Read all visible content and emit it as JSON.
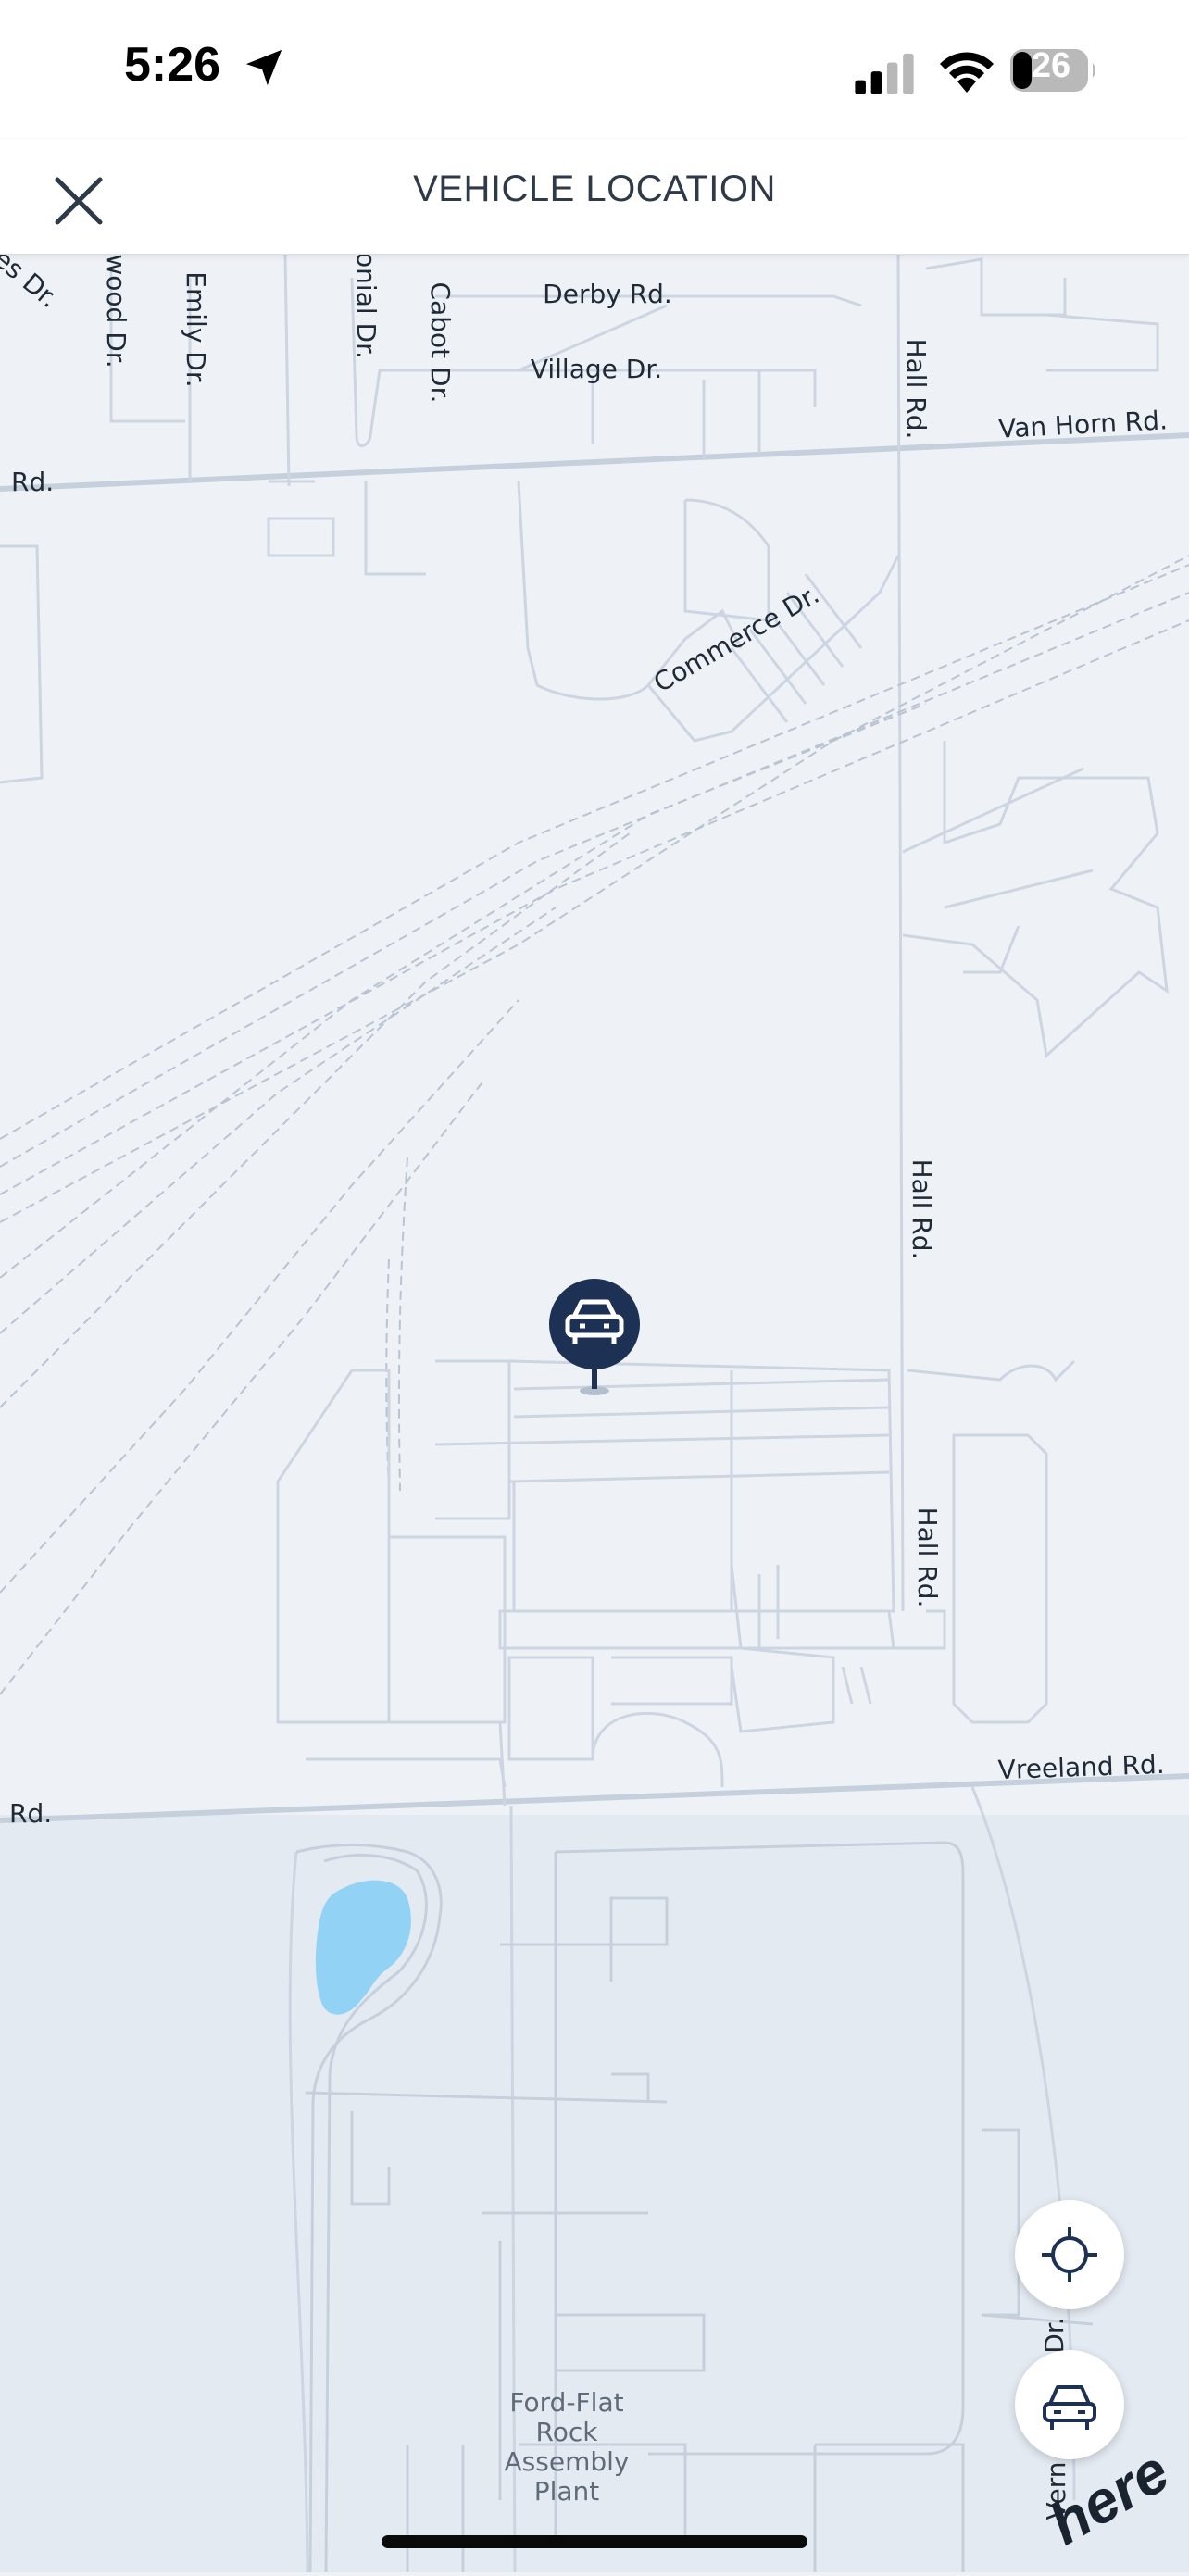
{
  "status_bar": {
    "time": "5:26",
    "battery": "26",
    "icons": [
      "location-arrow-icon",
      "cellular-signal-icon",
      "wifi-icon",
      "battery-icon"
    ]
  },
  "header": {
    "title": "VEHICLE LOCATION",
    "close_icon": "close-icon"
  },
  "map": {
    "roads": {
      "derby": "Derby Rd.",
      "village": "Village Dr.",
      "van_horn": "Van Horn Rd.",
      "rd_left_top": "Rd.",
      "commerce": "Commerce Dr.",
      "hall_top": "Hall Rd.",
      "hall_mid": "Hall Rd.",
      "hall_low": "Hall Rd.",
      "vreeland": "Vreeland Rd.",
      "rd_left_bottom": "Rd.",
      "cabot": "Cabot Dr.",
      "colonial": "onial Dr.",
      "emily": "Emily Dr.",
      "wood": "wood Dr.",
      "es": "es Dr.",
      "dr_right": "Dr.",
      "vern": "Vern"
    },
    "poi": [
      "Ford-Flat",
      "Rock",
      "Assembly",
      "Plant"
    ],
    "vehicle_marker_icon": "car-icon"
  },
  "controls": {
    "recenter_icon": "crosshair-icon",
    "vehicle_icon": "car-icon"
  },
  "branding": {
    "logo": "here"
  },
  "colors": {
    "map_background": "#eef2f7",
    "map_lower_background": "#e4eaf2",
    "road_lines": "#c9d3e0",
    "water": "#92d2f5",
    "marker": "#1d3155"
  }
}
